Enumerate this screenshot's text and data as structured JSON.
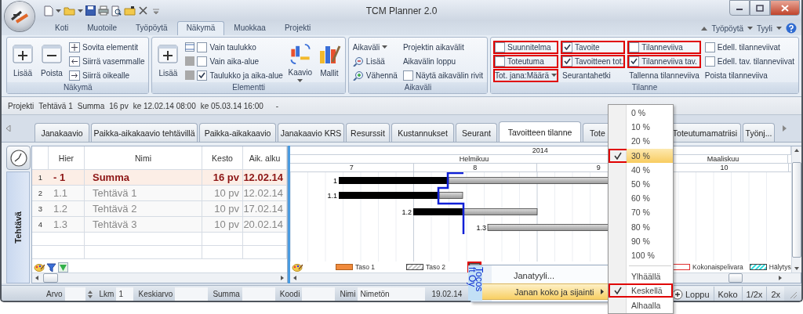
{
  "window": {
    "title": "TCM Planner 2.0"
  },
  "ribbon": {
    "tabs": [
      {
        "label": "Koti",
        "selected": false
      },
      {
        "label": "Muotoile",
        "selected": false
      },
      {
        "label": "Työpöytä",
        "selected": false
      },
      {
        "label": "Näkymä",
        "selected": true
      },
      {
        "label": "Muokkaa",
        "selected": false
      },
      {
        "label": "Projekti",
        "selected": false
      }
    ],
    "right_menus": [
      "Työpöytä",
      "Tyyli"
    ],
    "groups": [
      {
        "title": "Näkymä",
        "items": [
          {
            "kind": "big",
            "label": "Lisää"
          },
          {
            "kind": "big",
            "label": "Poista"
          },
          {
            "kind": "small",
            "label": "Sovita elementit"
          },
          {
            "kind": "small",
            "label": "Siirrä vasemmalle"
          },
          {
            "kind": "small",
            "label": "Siirrä oikealle"
          }
        ]
      },
      {
        "title": "Elementti",
        "items": [
          {
            "kind": "big",
            "label": "Lisää"
          },
          {
            "kind": "iconcheck",
            "label": "Vain taulukko",
            "checked": false
          },
          {
            "kind": "iconcheck",
            "label": "Vain aika-alue",
            "checked": false
          },
          {
            "kind": "iconcheck",
            "label": "Taulukko ja aika-alue",
            "checked": true
          },
          {
            "kind": "bigmenu",
            "label": "Kaavio"
          },
          {
            "kind": "big",
            "label": "Mallit"
          }
        ]
      },
      {
        "title": "Aikaväli",
        "items": [
          {
            "kind": "dropdown",
            "label": "Aikaväli"
          },
          {
            "kind": "small",
            "label": "Lisää"
          },
          {
            "kind": "small",
            "label": "Vähennä"
          },
          {
            "kind": "text",
            "label": "Projektin aikavälit"
          },
          {
            "kind": "text",
            "label": "Aikavälin loppu"
          },
          {
            "kind": "check",
            "label": "Näytä aikavälin rivit",
            "checked": false
          }
        ]
      },
      {
        "title": "Tilanne",
        "items": [
          {
            "kind": "check",
            "label": "Suunnitelma",
            "checked": false,
            "highlighted": true
          },
          {
            "kind": "check",
            "label": "Toteutuma",
            "checked": false,
            "highlighted": true
          },
          {
            "kind": "dropdown",
            "label": "Tot. jana:Määrä",
            "highlighted": true
          },
          {
            "kind": "check",
            "label": "Tavoite",
            "checked": true,
            "highlighted": true
          },
          {
            "kind": "check",
            "label": "Tavoitteen tot.",
            "checked": true,
            "highlighted": true
          },
          {
            "kind": "text",
            "label": "Seurantahetki",
            "highlighted": false
          },
          {
            "kind": "check",
            "label": "Tilanneviiva",
            "checked": false,
            "highlighted": true
          },
          {
            "kind": "check",
            "label": "Tilanneviiva tav.",
            "checked": true,
            "highlighted": true
          },
          {
            "kind": "text",
            "label": "Tallenna tilanneviiva",
            "highlighted": false
          },
          {
            "kind": "check",
            "label": "Edell. tilanneviivat",
            "checked": false,
            "highlighted": false
          },
          {
            "kind": "check",
            "label": "Edell. tav. tilanneviivat",
            "checked": false,
            "highlighted": false
          },
          {
            "kind": "text",
            "label": "Poista tilanneviiva",
            "highlighted": false
          }
        ]
      }
    ]
  },
  "info_bar": [
    "Projekti",
    "Tehtävä 1",
    "Summa",
    "16 pv",
    "ke 12.02.14 08:00",
    "ke 05.03.14 16:00",
    "-"
  ],
  "view_tabs": [
    {
      "label": "Janakaavio",
      "selected": false
    },
    {
      "label": "Paikka-aikakaavio tehtävillä",
      "selected": false
    },
    {
      "label": "Paikka-aikakaavio",
      "selected": false
    },
    {
      "label": "Janakaavio KRS",
      "selected": false
    },
    {
      "label": "Resurssit",
      "selected": false
    },
    {
      "label": "Kustannukset",
      "selected": false
    },
    {
      "label": "Seurant",
      "selected": false
    },
    {
      "label": "Tavoitteen tilanne",
      "selected": true
    },
    {
      "label": "Tote",
      "selected": false
    },
    {
      "label": "Toteutumamatriisi",
      "selected": false
    },
    {
      "label": "Työnj...",
      "selected": false
    }
  ],
  "side_label": "Tehtävä",
  "grid": {
    "columns": [
      "Hier",
      "Nimi",
      "Kesto",
      "Aik. alku"
    ],
    "rows": [
      {
        "kind": "summary",
        "number": "1",
        "hier": "- 1",
        "name": "Summa",
        "duration": "16 pv",
        "start": "12.02.14"
      },
      {
        "kind": "task",
        "number": "2",
        "hier": "1.1",
        "name": "Tehtävä 1",
        "duration": "10 pv",
        "start": "12.02.14"
      },
      {
        "kind": "task",
        "number": "3",
        "hier": "1.2",
        "name": "Tehtävä 2",
        "duration": "10 pv",
        "start": "17.02.14"
      },
      {
        "kind": "task",
        "number": "4",
        "hier": "1.3",
        "name": "Tehtävä 3",
        "duration": "10 pv",
        "start": "20.02.14"
      }
    ]
  },
  "gantt": {
    "year": "2014",
    "months": [
      "Helmikuu",
      "Maaliskuu"
    ],
    "weeks": [
      "7",
      "8",
      "9",
      "10"
    ],
    "bar_labels": [
      "1",
      "1.1",
      "1.2",
      "1.3"
    ],
    "legend": [
      {
        "kind": "solid",
        "label": "Taso 1",
        "color": "#f08a3c",
        "highlighted": false
      },
      {
        "kind": "hatched",
        "label": "Taso 2",
        "color": "#c8c8c8",
        "highlighted": false
      },
      {
        "kind": "gradient",
        "color": "#8a8a8a",
        "highlighted": true
      },
      {
        "kind": "outline",
        "label": "Kokonaispelivara",
        "color": "#e03030",
        "highlighted": false
      },
      {
        "kind": "hatched",
        "label": "Hälytys",
        "color": "#40e0e0",
        "highlighted": false
      }
    ]
  },
  "status_bar": {
    "left": [
      {
        "kind": "spin",
        "label": "Arvo"
      },
      {
        "kind": "field",
        "label": "Lkm",
        "value": "1"
      },
      {
        "kind": "field",
        "label": "Keskiarvo"
      },
      {
        "kind": "field",
        "label": "Summa"
      },
      {
        "kind": "field",
        "label": "Koodi"
      },
      {
        "kind": "field",
        "label": "Nimi",
        "value": "Nimetön"
      },
      {
        "kind": "text",
        "label": "19.02.14"
      }
    ],
    "right": [
      {
        "kind": "plus",
        "label": "Loppu"
      },
      {
        "kind": "button",
        "label": "Koko"
      },
      {
        "kind": "button",
        "label": "1/2x"
      },
      {
        "kind": "button",
        "label": "2x"
      }
    ]
  },
  "context_menu": {
    "items": [
      {
        "label": "Janatyyli...",
        "submenu": false,
        "selected": false
      },
      {
        "label": "Janan koko ja sijainti",
        "submenu": true,
        "selected": true
      }
    ]
  },
  "tooltip": {
    "lines": [
      "Tocos",
      "ft Oy"
    ]
  },
  "submenu": {
    "sections": [
      {
        "items": [
          {
            "label": "0 %",
            "checked": false,
            "selected": false,
            "highlighted": false
          },
          {
            "label": "10 %",
            "checked": false,
            "selected": false,
            "highlighted": false
          },
          {
            "label": "20 %",
            "checked": false,
            "selected": false,
            "highlighted": false
          },
          {
            "label": "30 %",
            "checked": true,
            "selected": true,
            "highlighted": true
          },
          {
            "label": "40 %",
            "checked": false,
            "selected": false,
            "highlighted": false
          },
          {
            "label": "50 %",
            "checked": false,
            "selected": false,
            "highlighted": false
          },
          {
            "label": "60 %",
            "checked": false,
            "selected": false,
            "highlighted": false
          },
          {
            "label": "70 %",
            "checked": false,
            "selected": false,
            "highlighted": false
          },
          {
            "label": "80 %",
            "checked": false,
            "selected": false,
            "highlighted": false
          },
          {
            "label": "90 %",
            "checked": false,
            "selected": false,
            "highlighted": false
          },
          {
            "label": "100 %",
            "checked": false,
            "selected": false,
            "highlighted": false
          }
        ]
      },
      {
        "items": [
          {
            "label": "Ylhäällä",
            "checked": false,
            "selected": false,
            "highlighted": false
          },
          {
            "label": "Keskellä",
            "checked": true,
            "selected": false,
            "highlighted": true
          },
          {
            "label": "Alhaalla",
            "checked": false,
            "selected": false,
            "highlighted": false
          }
        ]
      }
    ]
  }
}
